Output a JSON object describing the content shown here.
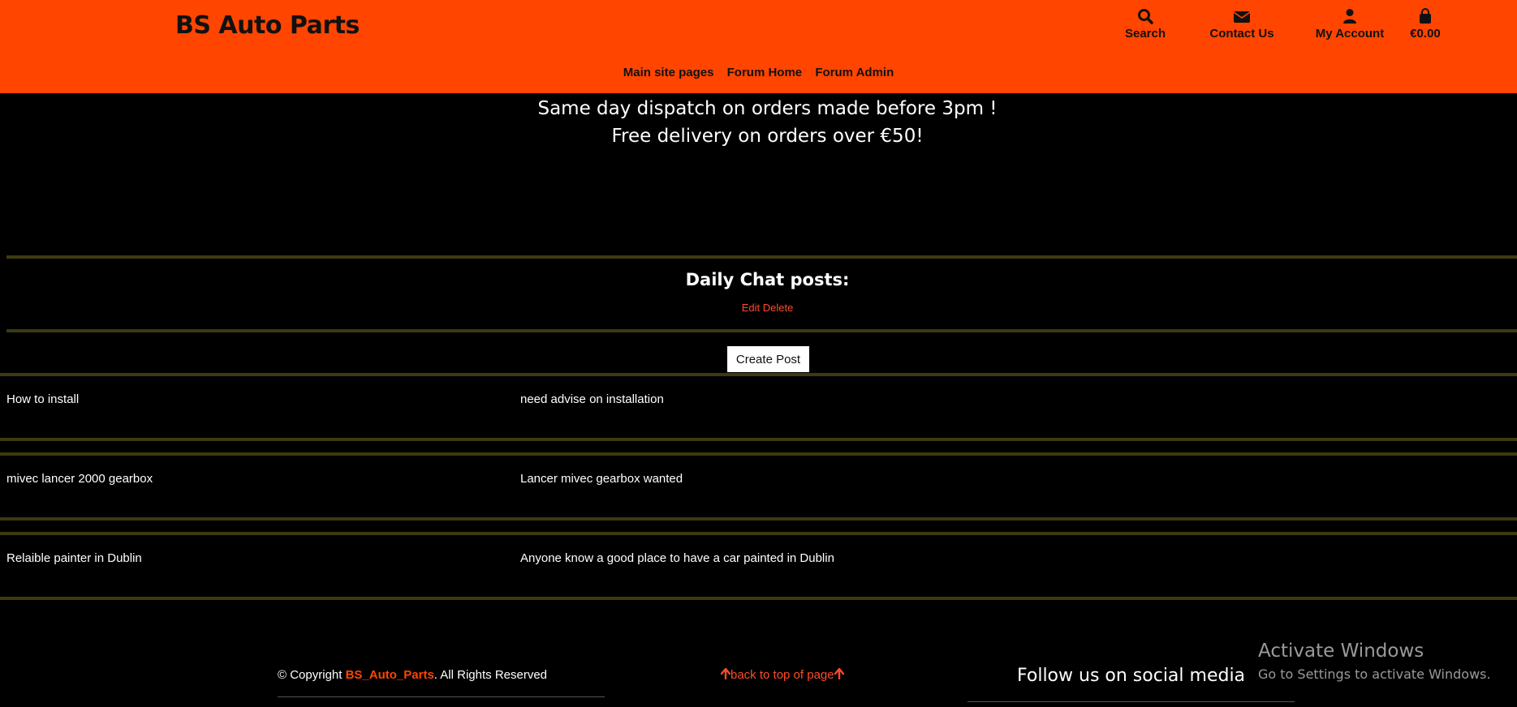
{
  "header": {
    "brand": "BS Auto Parts",
    "nav": {
      "search": "Search",
      "contact": "Contact Us",
      "account": "My Account",
      "bag": "€0.00"
    },
    "subnav": [
      "Main site pages",
      "Forum Home",
      "Forum Admin"
    ],
    "accent_color": "#ff4500"
  },
  "promo": {
    "line1": "Same day dispatch on orders made before 3pm !",
    "line2": "Free delivery on orders over €50!"
  },
  "forum": {
    "title": "Daily Chat posts:",
    "edit": "Edit",
    "delete": "Delete",
    "create_post": "Create Post",
    "posts": [
      {
        "title": "How to install",
        "description": "need advise on installation"
      },
      {
        "title": "mivec lancer 2000 gearbox",
        "description": "Lancer mivec gearbox wanted"
      },
      {
        "title": "Relaible painter in Dublin",
        "description": "Anyone know a good place to have a car painted in Dublin"
      }
    ]
  },
  "footer": {
    "copyright_prefix": "© Copyright ",
    "copyright_brand": "BS_Auto_Parts",
    "copyright_suffix": ". All Rights Reserved",
    "back_to_top": "back to top of page",
    "social_heading": "Follow us on social media"
  },
  "watermark": {
    "line1": "Activate Windows",
    "line2": "Go to Settings to activate Windows."
  }
}
